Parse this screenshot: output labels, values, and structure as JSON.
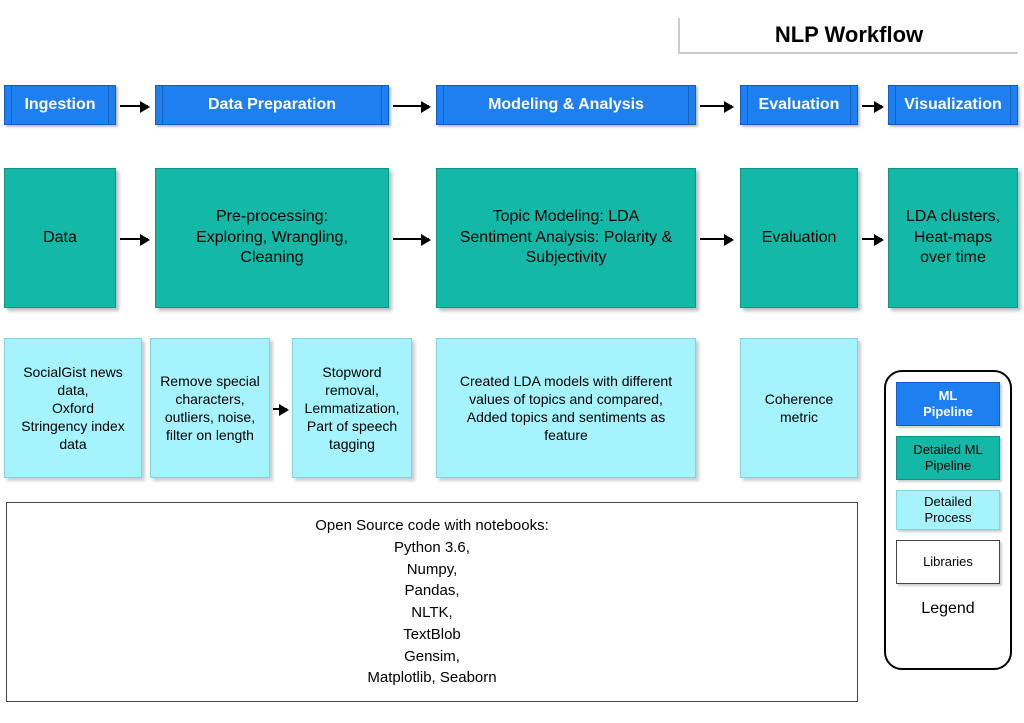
{
  "title": "NLP Workflow",
  "stages": {
    "ingestion": "Ingestion",
    "prep": "Data Preparation",
    "model": "Modeling & Analysis",
    "eval": "Evaluation",
    "viz": "Visualization"
  },
  "teal": {
    "data": "Data",
    "preproc": "Pre-processing:\nExploring, Wrangling,\nCleaning",
    "model": "Topic Modeling: LDA\nSentiment Analysis: Polarity &\nSubjectivity",
    "eval": "Evaluation",
    "viz": "LDA clusters,\nHeat-maps\nover time"
  },
  "cyan": {
    "sources": "SocialGist news\ndata,\nOxford\nStringency index\ndata",
    "clean1": "Remove special\ncharacters,\noutliers, noise,\nfilter on length",
    "clean2": "Stopword\nremoval,\nLemmatization,\nPart of speech\ntagging",
    "lda": "Created LDA models with different\nvalues of topics and compared,\nAdded topics and sentiments as\nfeature",
    "coh": "Coherence\nmetric"
  },
  "libs": "Open Source code with notebooks:\nPython 3.6,\nNumpy,\nPandas,\nNLTK,\nTextBlob\nGensim,\nMatplotlib, Seaborn",
  "legend": {
    "ml": "ML\nPipeline",
    "detailed_ml": "Detailed ML\nPipeline",
    "process": "Detailed Process",
    "libs": "Libraries",
    "caption": "Legend"
  }
}
